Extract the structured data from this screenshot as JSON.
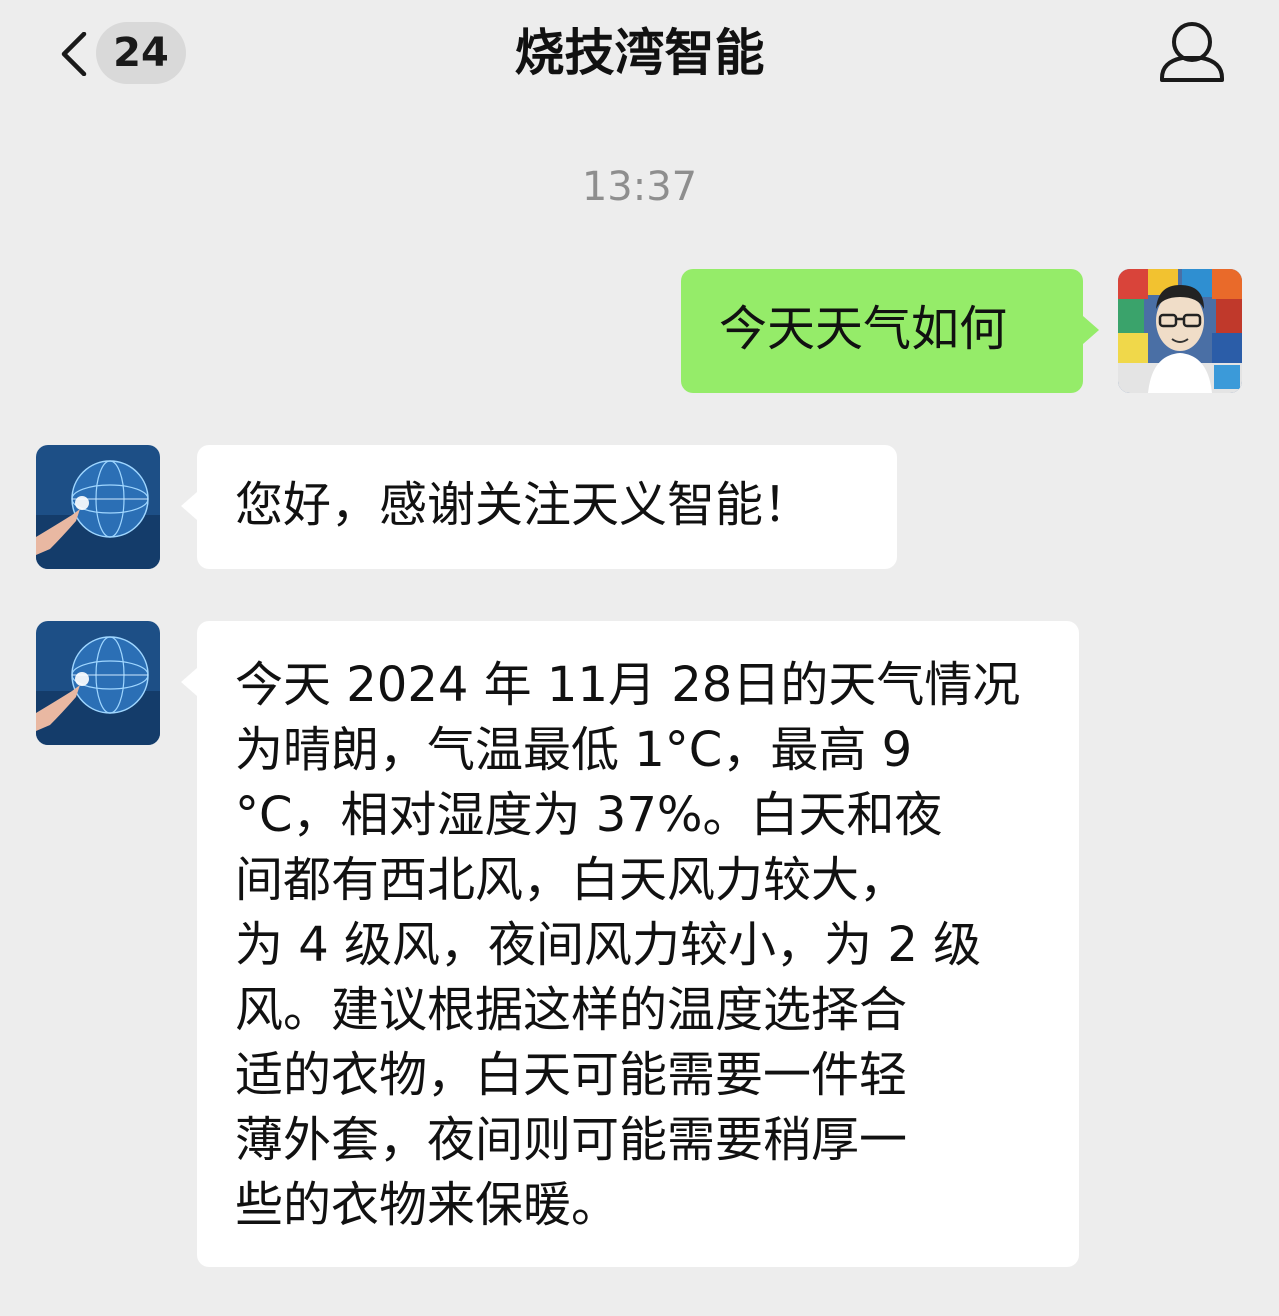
{
  "header": {
    "unread_count": "24",
    "title": "烧技湾智能"
  },
  "timestamp": "13:37",
  "messages": [
    {
      "sender": "me",
      "text": "今天天气如何"
    },
    {
      "sender": "bot",
      "text": "您好，感谢关注天义智能！"
    },
    {
      "sender": "bot",
      "lines": [
        "今天 2024 年 11月 28日的天气情况",
        "为晴朗，气温最低 1°C，最高 9",
        "°C，相对湿度为 37%。白天和夜",
        "间都有西北风，白天风力较大，",
        "为 4 级风，夜间风力较小，为 2 级",
        "风。建议根据这样的温度选择合",
        "适的衣物，白天可能需要一件轻",
        "薄外套，夜间则可能需要稍厚一",
        "些的衣物来保暖。"
      ]
    }
  ],
  "colors": {
    "background": "#ededed",
    "outgoing_bubble": "#95ec69",
    "incoming_bubble": "#ffffff",
    "timestamp_text": "#8e8e8e",
    "badge_background": "#d9d9d9"
  },
  "icons": {
    "back": "chevron-left-icon",
    "profile": "person-outline-icon"
  }
}
